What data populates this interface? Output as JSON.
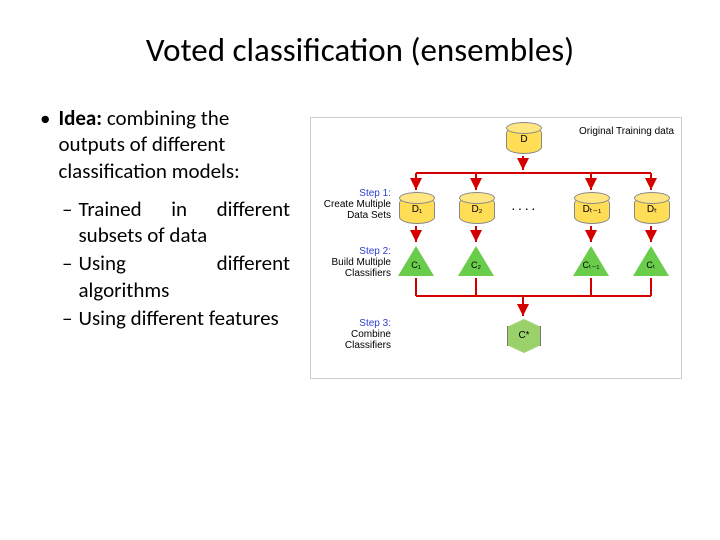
{
  "title": "Voted classification (ensembles)",
  "idea_label": "Idea:",
  "idea_text": "combining the outputs of different classification models:",
  "sub_bullets": [
    "Trained in different subsets of data",
    "Using different algorithms",
    "Using different features"
  ],
  "diagram": {
    "orig_label": "Original Training data",
    "top_node": "D",
    "step1": {
      "blue": "Step 1:",
      "text": "Create Multiple Data Sets"
    },
    "step2": {
      "blue": "Step 2:",
      "text": "Build Multiple Classifiers"
    },
    "step3": {
      "blue": "Step 3:",
      "text": "Combine Classifiers"
    },
    "data_nodes": [
      "D₁",
      "D₂",
      "Dₜ₋₁",
      "Dₜ"
    ],
    "classifier_nodes": [
      "C₁",
      "C₂",
      "Cₜ₋₁",
      "Cₜ"
    ],
    "dots": "····",
    "final_node": "C*"
  }
}
